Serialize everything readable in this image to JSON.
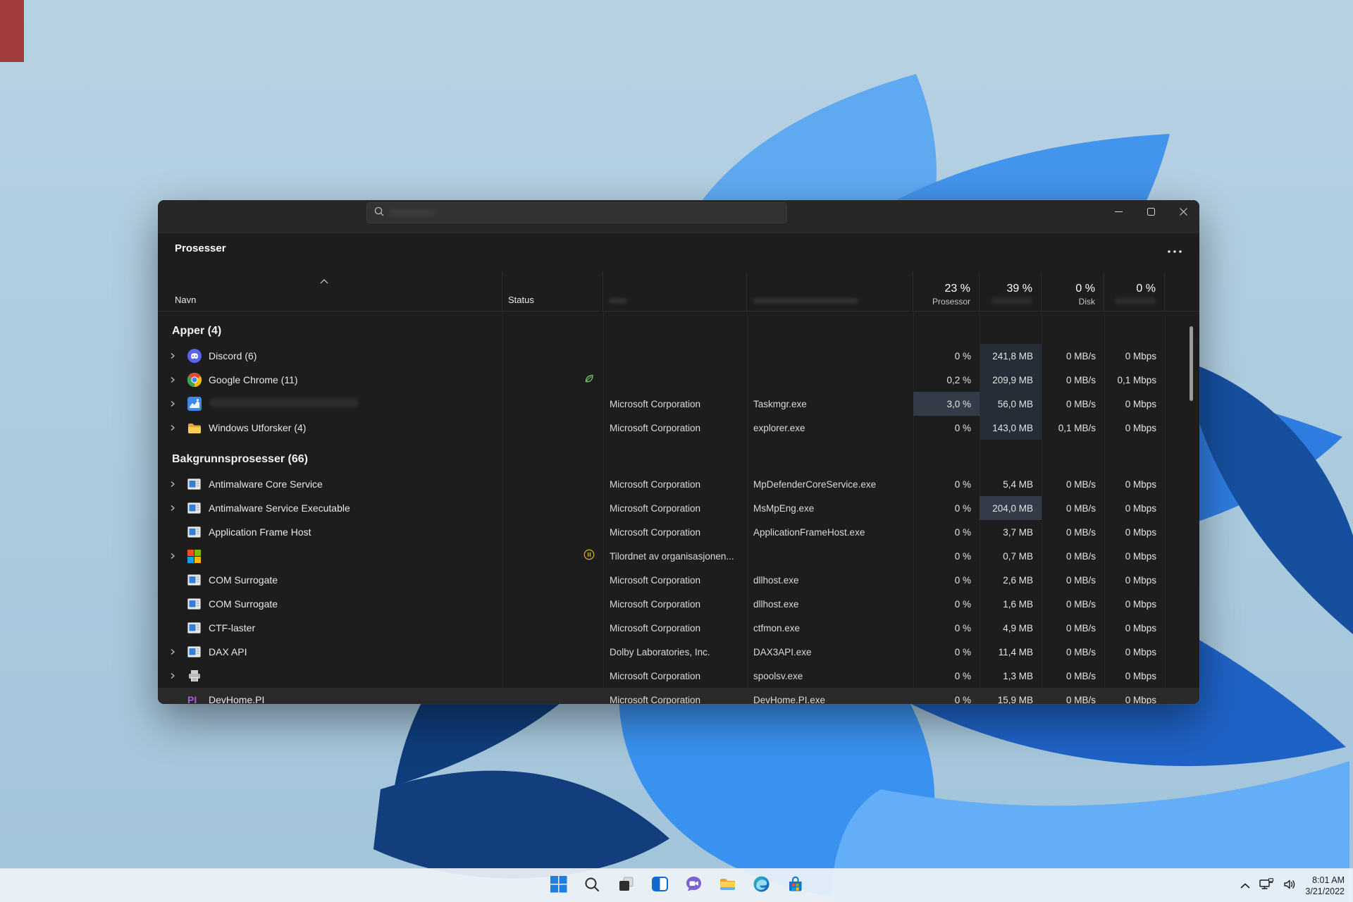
{
  "desktop": {
    "taskbar": {
      "icons": [
        {
          "name": "start"
        },
        {
          "name": "search"
        },
        {
          "name": "task-view"
        },
        {
          "name": "widgets"
        },
        {
          "name": "chat"
        },
        {
          "name": "file-explorer"
        },
        {
          "name": "edge"
        },
        {
          "name": "microsoft-store"
        }
      ],
      "tray": {
        "time": "8:01 AM",
        "date": "3/21/2022"
      }
    }
  },
  "window": {
    "search_placeholder": "",
    "page_title": "Prosesser",
    "columns": {
      "name": "Navn",
      "status": "Status",
      "publisher": "",
      "process_name": "",
      "cpu_value": "23 %",
      "cpu_label": "Prosessor",
      "mem_value": "39 %",
      "mem_label": "",
      "disk_value": "0 %",
      "disk_label": "Disk",
      "net_value": "0 %",
      "net_label": ""
    },
    "sections": [
      {
        "label": "Apper (4)",
        "rows": [
          {
            "icon": "discord",
            "chevron": true,
            "name": "Discord (6)",
            "publisher": "",
            "exe": "",
            "cpu": "0 %",
            "mem": "241,8 MB",
            "disk": "0 MB/s",
            "net": "0 Mbps",
            "mem_hl": 1
          },
          {
            "icon": "chrome",
            "chevron": true,
            "name": "Google Chrome (11)",
            "status": "efficiency",
            "publisher": "",
            "exe": "",
            "cpu": "0,2 %",
            "mem": "209,9 MB",
            "disk": "0 MB/s",
            "net": "0,1 Mbps",
            "mem_hl": 1
          },
          {
            "icon": "taskmgr",
            "chevron": true,
            "name": "",
            "redacted": true,
            "publisher": "Microsoft Corporation",
            "exe": "Taskmgr.exe",
            "cpu": "3,0 %",
            "mem": "56,0 MB",
            "disk": "0 MB/s",
            "net": "0 Mbps",
            "cpu_hl": 2,
            "mem_hl": 1
          },
          {
            "icon": "folder",
            "chevron": true,
            "name": "Windows Utforsker (4)",
            "publisher": "Microsoft Corporation",
            "exe": "explorer.exe",
            "cpu": "0 %",
            "mem": "143,0 MB",
            "disk": "0,1 MB/s",
            "net": "0 Mbps",
            "mem_hl": 1
          }
        ]
      },
      {
        "label": "Bakgrunnsprosesser (66)",
        "rows": [
          {
            "icon": "app-window",
            "chevron": true,
            "name": "Antimalware Core Service",
            "publisher": "Microsoft Corporation",
            "exe": "MpDefenderCoreService.exe",
            "cpu": "0 %",
            "mem": "5,4 MB",
            "disk": "0 MB/s",
            "net": "0 Mbps"
          },
          {
            "icon": "app-window",
            "chevron": true,
            "name": "Antimalware Service Executable",
            "publisher": "Microsoft Corporation",
            "exe": "MsMpEng.exe",
            "cpu": "0 %",
            "mem": "204,0 MB",
            "disk": "0 MB/s",
            "net": "0 Mbps",
            "mem_hl": 2
          },
          {
            "icon": "app-window",
            "chevron": false,
            "name": "Application Frame Host",
            "publisher": "Microsoft Corporation",
            "exe": "ApplicationFrameHost.exe",
            "cpu": "0 %",
            "mem": "3,7 MB",
            "disk": "0 MB/s",
            "net": "0 Mbps"
          },
          {
            "icon": "ms-logo",
            "chevron": true,
            "name": "",
            "status": "suspended",
            "publisher": "Tilordnet av organisasjonen...",
            "exe": "",
            "cpu": "0 %",
            "mem": "0,7 MB",
            "disk": "0 MB/s",
            "net": "0 Mbps"
          },
          {
            "icon": "app-window",
            "chevron": false,
            "name": "COM Surrogate",
            "publisher": "Microsoft Corporation",
            "exe": "dllhost.exe",
            "cpu": "0 %",
            "mem": "2,6 MB",
            "disk": "0 MB/s",
            "net": "0 Mbps"
          },
          {
            "icon": "app-window",
            "chevron": false,
            "name": "COM Surrogate",
            "publisher": "Microsoft Corporation",
            "exe": "dllhost.exe",
            "cpu": "0 %",
            "mem": "1,6 MB",
            "disk": "0 MB/s",
            "net": "0 Mbps"
          },
          {
            "icon": "app-window",
            "chevron": false,
            "name": "CTF-laster",
            "publisher": "Microsoft Corporation",
            "exe": "ctfmon.exe",
            "cpu": "0 %",
            "mem": "4,9 MB",
            "disk": "0 MB/s",
            "net": "0 Mbps"
          },
          {
            "icon": "app-window",
            "chevron": true,
            "name": "DAX API",
            "publisher": "Dolby Laboratories, Inc.",
            "exe": "DAX3API.exe",
            "cpu": "0 %",
            "mem": "11,4 MB",
            "disk": "0 MB/s",
            "net": "0 Mbps"
          },
          {
            "icon": "printer",
            "chevron": true,
            "name": "",
            "publisher": "Microsoft Corporation",
            "exe": "spoolsv.exe",
            "cpu": "0 %",
            "mem": "1,3 MB",
            "disk": "0 MB/s",
            "net": "0 Mbps"
          },
          {
            "icon": "devhome-pi",
            "chevron": false,
            "name": "DevHome.PI",
            "publisher": "Microsoft Corporation",
            "exe": "DevHome.PI.exe",
            "cpu": "0 %",
            "mem": "15,9 MB",
            "disk": "0 MB/s",
            "net": "0 Mbps",
            "row_hl": true
          }
        ]
      }
    ]
  }
}
